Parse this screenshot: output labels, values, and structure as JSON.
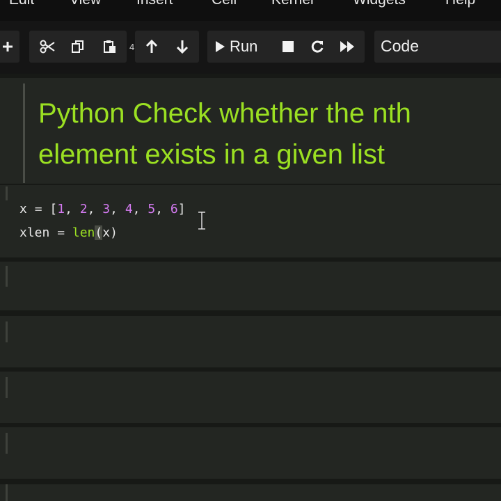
{
  "menu": {
    "items": [
      "Edit",
      "View",
      "Insert",
      "Cell",
      "Kernel",
      "Widgets",
      "Help"
    ]
  },
  "toolbar": {
    "small_badge": "4",
    "run_label": "Run",
    "cell_type": "Code",
    "icons": [
      "plus-icon",
      "cut-icon",
      "copy-icon",
      "paste-icon",
      "arrow-up-icon",
      "arrow-down-icon",
      "run-icon",
      "stop-icon",
      "restart-icon",
      "fast-forward-icon"
    ]
  },
  "markdown_cell": {
    "text": "Python Check whether the nth element exists in a given list"
  },
  "code_cell": {
    "lines": [
      "x = [1, 2, 3, 4, 5, 6]",
      "xlen = len(x)"
    ]
  },
  "colors": {
    "heading_green": "#9be022",
    "number_purple": "#d37af0",
    "background": "#181a17",
    "cell_background": "#232622"
  }
}
